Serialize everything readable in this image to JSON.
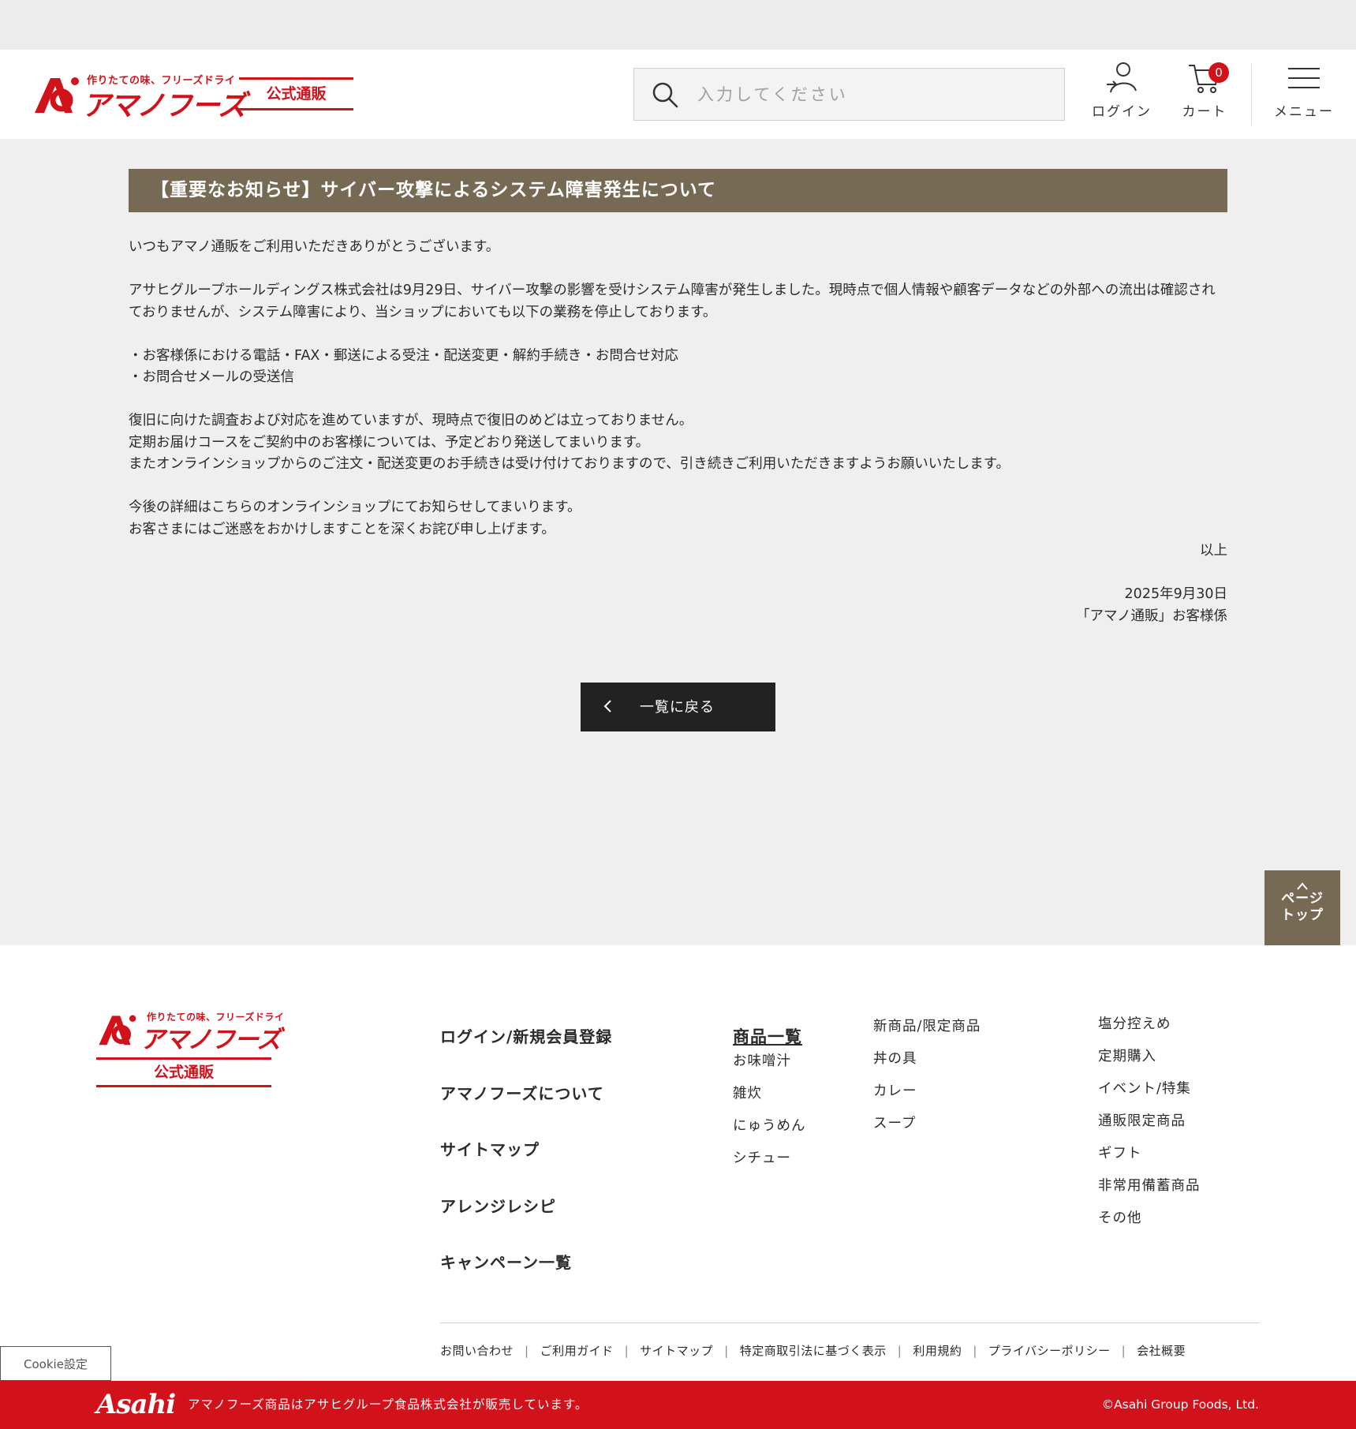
{
  "header": {
    "logo_tagline": "作りたての味、フリーズドライ",
    "logo_name": "アマノフーズ",
    "official_badge": "公式通販",
    "search_placeholder": "入力してください",
    "login_label": "ログイン",
    "cart_label": "カート",
    "cart_count": "0",
    "menu_label": "メニュー"
  },
  "notice": {
    "title": "【重要なお知らせ】サイバー攻撃によるシステム障害発生について",
    "greeting": "いつもアマノ通販をご利用いただきありがとうございます。",
    "para1": "アサヒグループホールディングス株式会社は9月29日、サイバー攻撃の影響を受けシステム障害が発生しました。現時点で個人情報や顧客データなどの外部への流出は確認されておりませんが、システム障害により、当ショップにおいても以下の業務を停止しております。",
    "bullet1": "・お客様係における電話・FAX・郵送による受注・配送変更・解約手続き・お問合せ対応",
    "bullet2": "・お問合せメールの受送信",
    "para2_line1": "復旧に向けた調査および対応を進めていますが、現時点で復旧のめどは立っておりません。",
    "para2_line2": "定期お届けコースをご契約中のお客様については、予定どおり発送してまいります。",
    "para2_line3": "またオンラインショップからのご注文・配送変更のお手続きは受け付けておりますので、引き続きご利用いただきますようお願いいたします。",
    "para3_line1": "今後の詳細はこちらのオンラインショップにてお知らせしてまいります。",
    "para3_line2": "お客さまにはご迷惑をおかけしますことを深くお詫び申し上げます。",
    "closing": "以上",
    "date": "2025年9月30日",
    "signature": "「アマノ通販」お客様係"
  },
  "back_button": "一覧に戻る",
  "page_top": {
    "line1": "ページ",
    "line2": "トップ"
  },
  "footer": {
    "logo_tagline": "作りたての味、フリーズドライ",
    "logo_name": "アマノフーズ",
    "official_badge": "公式通販",
    "main_links": [
      "ログイン/新規会員登録",
      "アマノフーズについて",
      "サイトマップ",
      "アレンジレシピ",
      "キャンペーン一覧"
    ],
    "products_heading": "商品一覧",
    "products_col1": [
      "お味噌汁",
      "雑炊",
      "にゅうめん",
      "シチュー"
    ],
    "products_col2": [
      "新商品/限定商品",
      "丼の具",
      "カレー",
      "スープ"
    ],
    "products_col3": [
      "塩分控えめ",
      "定期購入",
      "イベント/特集",
      "通販限定商品",
      "ギフト",
      "非常用備蓄商品",
      "その他"
    ],
    "bottom_links": [
      "お問い合わせ",
      "ご利用ガイド",
      "サイトマップ",
      "特定商取引法に基づく表示",
      "利用規約",
      "プライバシーポリシー",
      "会社概要"
    ],
    "cookie_button": "Cookie設定",
    "brand": "Asahi",
    "sales_note": "アマノフーズ商品はアサヒグループ食品株式会社が販売しています。",
    "copyright": "©Asahi Group Foods, Ltd."
  },
  "colors": {
    "brand_red": "#d2121a",
    "title_bar": "#776a54",
    "dark_button": "#222222"
  },
  "icons": [
    "search-icon",
    "user-icon",
    "cart-icon",
    "hamburger-icon",
    "chevron-left-icon",
    "chevron-up-icon"
  ]
}
